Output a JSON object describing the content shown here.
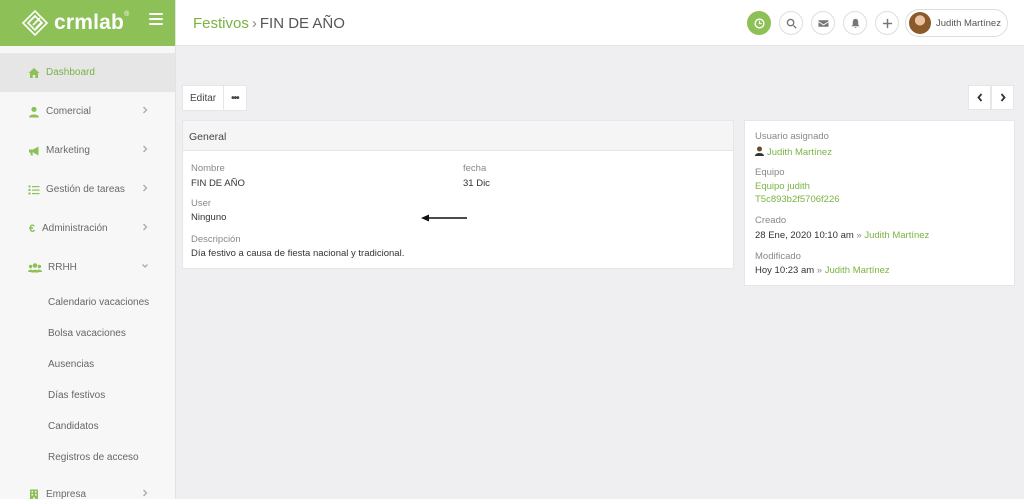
{
  "brand": {
    "name": "crmlab",
    "mark": "®"
  },
  "sidebar": {
    "items": [
      {
        "label": "Dashboard"
      },
      {
        "label": "Comercial"
      },
      {
        "label": "Marketing"
      },
      {
        "label": "Gestión de tareas"
      },
      {
        "label": "Administración",
        "icon_glyph": "€"
      },
      {
        "label": "RRHH"
      }
    ],
    "rrhh_subitems": [
      "Calendario vacaciones",
      "Bolsa vacaciones",
      "Ausencias",
      "Días festivos",
      "Candidatos",
      "Registros de acceso"
    ],
    "empresa_label": "Empresa"
  },
  "header": {
    "breadcrumb_parent": "Festivos",
    "breadcrumb_separator": "›",
    "breadcrumb_current": "FIN DE AÑO",
    "user_name": "Judith Martínez"
  },
  "actions": {
    "edit_label": "Editar",
    "more_label": "•••"
  },
  "general": {
    "title": "General",
    "name_label": "Nombre",
    "name_value": "FIN DE AÑO",
    "date_label": "fecha",
    "date_value": "31 Dic",
    "user_label": "User",
    "user_value": "Ninguno",
    "description_label": "Descripción",
    "description_value": "Día festivo a causa de fiesta nacional y tradicional."
  },
  "info": {
    "assigned_label": "Usuario asignado",
    "assigned_value": "Judith Martínez",
    "team_label": "Equipo",
    "team_value": "Equipo judith",
    "team_id": "T5c893b2f5706f226",
    "created_label": "Creado",
    "created_value": "28 Ene, 2020 10:10 am",
    "created_sep": "»",
    "created_by": "Judith Martínez",
    "modified_label": "Modificado",
    "modified_value": "Hoy 10:23 am",
    "modified_sep": "»",
    "modified_by": "Judith Martínez"
  },
  "colors": {
    "accent": "#8dc157",
    "link": "#7ab343",
    "background": "#efeff2"
  }
}
